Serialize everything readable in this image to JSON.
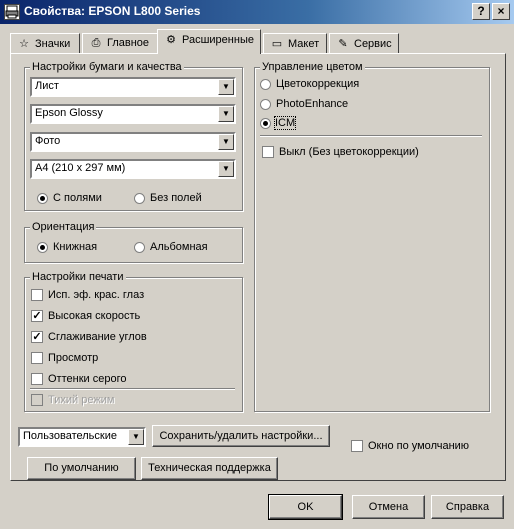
{
  "window": {
    "title": "Свойства: EPSON L800 Series",
    "help_label": "?",
    "close_label": "×"
  },
  "tabs": [
    {
      "label": "Значки",
      "icon": "star-icon"
    },
    {
      "label": "Главное",
      "icon": "printer-icon"
    },
    {
      "label": "Расширенные",
      "icon": "gears-icon",
      "active": true
    },
    {
      "label": "Макет",
      "icon": "page-icon"
    },
    {
      "label": "Сервис",
      "icon": "wrench-icon"
    }
  ],
  "paper_quality": {
    "title": "Настройки бумаги и качества",
    "paper_source": "Лист",
    "paper_type": "Epson Glossy",
    "quality": "Фото",
    "paper_size": "A4 (210 x 297 мм)",
    "borders": {
      "with": "С полями",
      "without": "Без полей",
      "selected": "with"
    }
  },
  "orientation": {
    "title": "Ориентация",
    "portrait": "Книжная",
    "landscape": "Альбомная",
    "selected": "portrait"
  },
  "print_settings": {
    "title": "Настройки печати",
    "options": [
      {
        "label": "Исп. эф. крас. глаз",
        "checked": false,
        "disabled": false
      },
      {
        "label": "Высокая скорость",
        "checked": true,
        "disabled": false
      },
      {
        "label": "Сглаживание углов",
        "checked": true,
        "disabled": false
      },
      {
        "label": "Просмотр",
        "checked": false,
        "disabled": false
      },
      {
        "label": "Оттенки серого",
        "checked": false,
        "disabled": false
      },
      {
        "label": "Тихий режим",
        "checked": false,
        "disabled": true
      }
    ]
  },
  "color_management": {
    "title": "Управление цветом",
    "options": [
      "Цветокоррекция",
      "PhotoEnhance",
      "ICM"
    ],
    "selected": "ICM",
    "off_label": "Выкл (Без цветокоррекции)",
    "off_checked": false
  },
  "custom_select": "Пользовательские",
  "save_delete_label": "Сохранить/удалить настройки...",
  "default_window_label": "Окно по умолчанию",
  "default_window_checked": false,
  "defaults_label": "По умолчанию",
  "support_label": "Техническая поддержка",
  "ok_label": "OK",
  "cancel_label": "Отмена",
  "help_button_label": "Справка",
  "colors": {
    "titlebar_start": "#0a246a",
    "titlebar_end": "#a6caf0",
    "face": "#d4d0c8"
  }
}
